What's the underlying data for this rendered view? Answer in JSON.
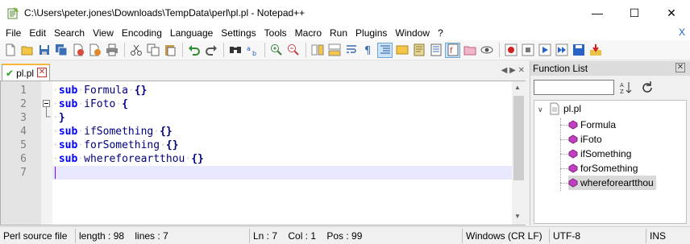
{
  "window": {
    "title": "C:\\Users\\peter.jones\\Downloads\\TempData\\perl\\pl.pl - Notepad++",
    "minimize_glyph": "—",
    "maximize_glyph": "☐",
    "close_glyph": "✕"
  },
  "menu": {
    "items": [
      "File",
      "Edit",
      "Search",
      "View",
      "Encoding",
      "Language",
      "Settings",
      "Tools",
      "Macro",
      "Run",
      "Plugins",
      "Window",
      "?"
    ],
    "close_glyph": "X"
  },
  "toolbar": {
    "icons": [
      "new-file-icon",
      "open-file-icon",
      "save-icon",
      "save-all-icon",
      "close-icon",
      "close-all-icon",
      "print-icon",
      "cut-icon",
      "copy-icon",
      "paste-icon",
      "undo-icon",
      "redo-icon",
      "find-icon",
      "replace-icon",
      "zoom-in-icon",
      "zoom-out-icon",
      "sync-vertical-icon",
      "sync-horizontal-icon",
      "word-wrap-icon",
      "show-all-chars-icon",
      "indent-guide-icon",
      "user-language-icon",
      "doc-map-icon",
      "function-list-icon",
      "folder-workspace-icon",
      "monitoring-icon",
      "record-macro-icon",
      "stop-macro-icon",
      "play-macro-icon",
      "play-multiple-icon",
      "save-macro-icon",
      "launch-icon"
    ]
  },
  "tab": {
    "label": "pl.pl",
    "close_glyph": "✕",
    "arrows": "◀ ▶ ✕"
  },
  "editor": {
    "line_numbers": [
      "1",
      "2",
      "3",
      "4",
      "5",
      "6",
      "7"
    ],
    "lines": [
      {
        "kw": "sub",
        "name": "Formula",
        "rest": "{}"
      },
      {
        "kw": "sub",
        "name": "iFoto",
        "rest": "{"
      },
      {
        "kw": "",
        "name": "",
        "rest": "}"
      },
      {
        "kw": "sub",
        "name": "ifSomething",
        "rest": "{}"
      },
      {
        "kw": "sub",
        "name": "forSomething",
        "rest": "{}"
      },
      {
        "kw": "sub",
        "name": "whereforeartthou",
        "rest": "{}"
      },
      {
        "kw": "",
        "name": "",
        "rest": ""
      }
    ],
    "current_line": 7
  },
  "function_list": {
    "title": "Function List",
    "close_glyph": "✕",
    "search_value": "",
    "root": "pl.pl",
    "functions": [
      "Formula",
      "iFoto",
      "ifSomething",
      "forSomething",
      "whereforeartthou"
    ],
    "selected": "whereforeartthou"
  },
  "status": {
    "file_type": "Perl source file",
    "length": "length : 98    lines : 7",
    "position": "Ln : 7    Col : 1    Pos : 99",
    "eol": "Windows (CR LF)",
    "encoding": "UTF-8",
    "mode": "INS"
  },
  "colors": {
    "keyword": "#0000ff",
    "identifier": "#000080",
    "current_line": "#e8e8ff",
    "function_icon": "#c040c0"
  }
}
